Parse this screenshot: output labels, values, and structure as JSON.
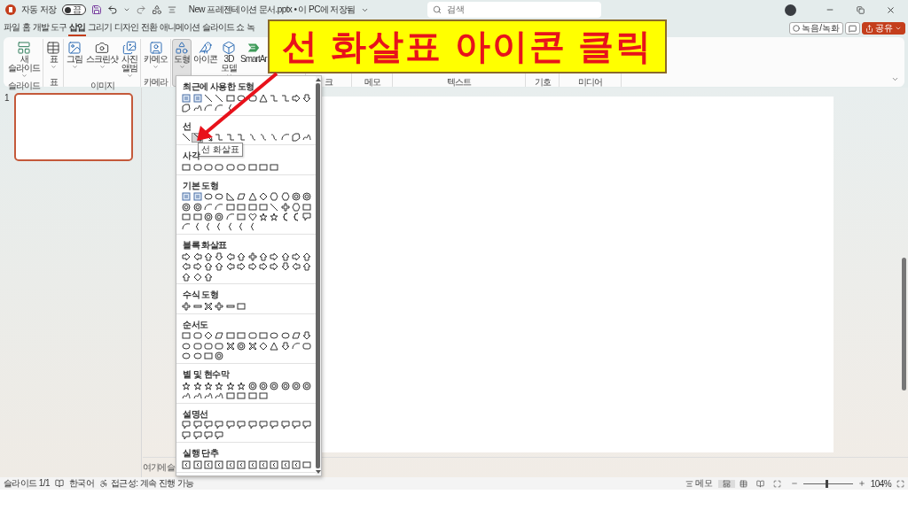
{
  "title_bar": {
    "autosave_label": "자동 저장",
    "autosave_toggle": {
      "text": "끔",
      "on": false
    },
    "document_title": "New 프레젠테이션 문서.pptx • 이 PC에 저장됨",
    "search": {
      "placeholder": "검색"
    }
  },
  "menu_tabs": [
    {
      "label": "파일",
      "selected": false
    },
    {
      "label": "홈",
      "selected": false
    },
    {
      "label": "개발 도구",
      "selected": false
    },
    {
      "label": "삽입",
      "selected": true
    },
    {
      "label": "그리기",
      "selected": false
    },
    {
      "label": "디자인",
      "selected": false
    },
    {
      "label": "전환",
      "selected": false
    },
    {
      "label": "애니메이션",
      "selected": false
    },
    {
      "label": "슬라이드 쇼",
      "selected": false
    },
    {
      "label": "녹",
      "selected": false
    }
  ],
  "header_buttons": [
    {
      "kind": "record",
      "label": "녹음/녹화"
    },
    {
      "kind": "comment"
    },
    {
      "kind": "share",
      "label": "공유"
    }
  ],
  "ribbon": {
    "groups": [
      {
        "label": "슬라이드",
        "commands": [
          {
            "lines": [
              "새",
              "슬라이드"
            ],
            "dropdown": true,
            "selected": false
          }
        ]
      },
      {
        "label": "표",
        "commands": [
          {
            "lines": [
              "표"
            ],
            "dropdown": true,
            "selected": false
          }
        ]
      },
      {
        "label": "이미지",
        "commands": [
          {
            "lines": [
              "그림"
            ],
            "dropdown": true,
            "selected": false
          },
          {
            "lines": [
              "스크린샷"
            ],
            "dropdown": true,
            "selected": false
          },
          {
            "lines": [
              "사진",
              "앨범"
            ],
            "dropdown": true,
            "selected": false
          }
        ]
      },
      {
        "label": "카메라",
        "commands": [
          {
            "lines": [
              "카메오"
            ],
            "dropdown": true,
            "selected": false
          }
        ]
      },
      {
        "commands": [
          {
            "lines": [
              "도형"
            ],
            "dropdown": true,
            "selected": true
          },
          {
            "lines": [
              "아이콘"
            ],
            "dropdown": false,
            "selected": false
          },
          {
            "lines": [
              "3D",
              "모델"
            ],
            "dropdown": true,
            "selected": false
          },
          {
            "lines": [
              "SmartAr"
            ],
            "dropdown": false,
            "selected": false
          }
        ]
      },
      {
        "label": "크"
      },
      {
        "label": "메모"
      },
      {
        "label": "텍스트"
      },
      {
        "label": "기호"
      },
      {
        "label": "미디어"
      }
    ]
  },
  "slide_panel": {
    "slides": [
      {
        "number": "1",
        "selected": true
      }
    ]
  },
  "notes": {
    "placeholder": "여기에 슬"
  },
  "shapes_menu": {
    "sections": [
      {
        "heading": "최근에 사용한 도형"
      },
      {
        "heading": "선",
        "items": [
          {
            "hovered": false
          },
          {
            "hovered": true
          },
          {
            "hovered": false
          },
          {
            "hovered": false
          },
          {
            "hovered": false
          },
          {
            "hovered": false
          },
          {
            "hovered": false
          },
          {
            "hovered": false
          },
          {
            "hovered": false
          },
          {
            "hovered": false
          },
          {
            "hovered": false
          },
          {
            "hovered": false
          }
        ]
      },
      {
        "heading": "사각"
      },
      {
        "heading": "기본 도형"
      },
      {
        "heading": "블록 화살표"
      },
      {
        "heading": "수식 도형"
      },
      {
        "heading": "순서도"
      },
      {
        "heading": "별 및 현수막"
      },
      {
        "heading": "설명선"
      },
      {
        "heading": "실행 단추"
      }
    ],
    "tooltip": "선 화살표"
  },
  "callout": {
    "text": "선 화살표 아이콘 클릭"
  },
  "status_bar": {
    "slide": "슬라이드 1/1",
    "language": "한국어",
    "accessibility": "접근성: 계속 진행 가능",
    "notes_button": "메모",
    "views": [
      {
        "kind": "normal",
        "selected": true
      },
      {
        "kind": "sorter",
        "selected": false
      },
      {
        "kind": "reading",
        "selected": false
      },
      {
        "kind": "show",
        "selected": false
      }
    ],
    "zoom": {
      "level": 0.48,
      "text": "104%"
    }
  }
}
